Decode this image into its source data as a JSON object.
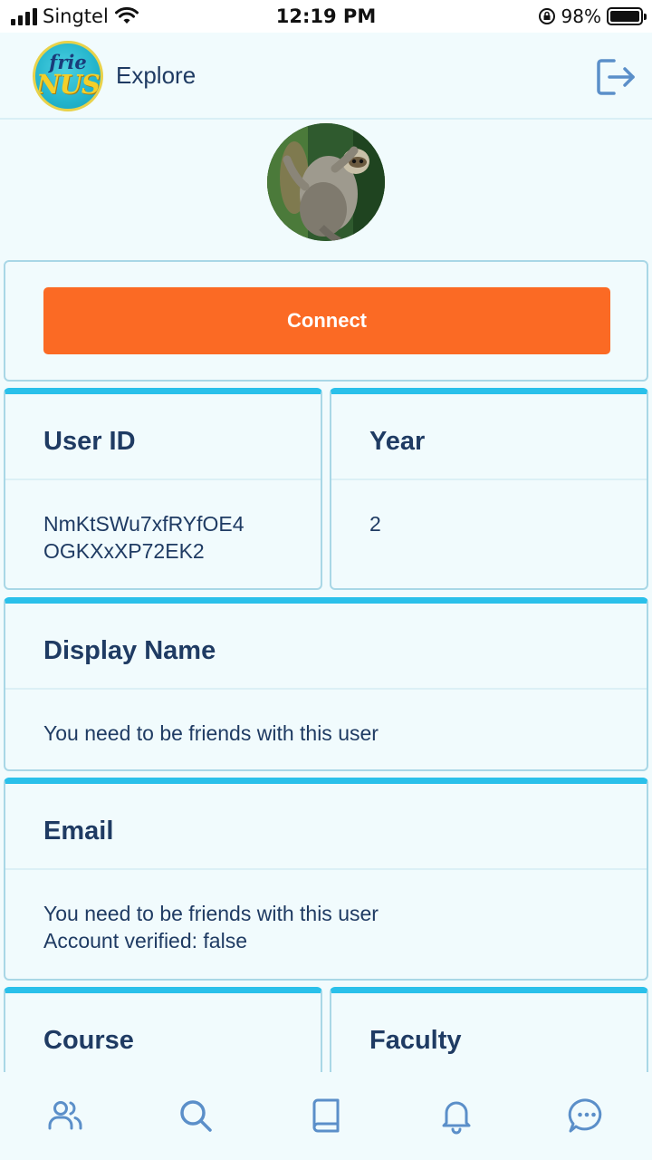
{
  "status_bar": {
    "carrier": "Singtel",
    "time": "12:19 PM",
    "battery": "98%"
  },
  "header": {
    "logo_line1": "frie",
    "logo_line2": "NUS",
    "title": "Explore"
  },
  "profile": {
    "connect_label": "Connect",
    "user_id": {
      "title": "User ID",
      "value_line1": "NmKtSWu7xfRYfOE4",
      "value_line2": "OGKXxXP72EK2"
    },
    "year": {
      "title": "Year",
      "value": "2"
    },
    "display_name": {
      "title": "Display Name",
      "value": "You need to be friends with this user"
    },
    "email": {
      "title": "Email",
      "value": "You need to be friends with this user",
      "verified": "Account verified: false"
    },
    "course": {
      "title": "Course"
    },
    "faculty": {
      "title": "Faculty"
    }
  },
  "nav": {
    "items": [
      {
        "icon": "users-icon"
      },
      {
        "icon": "search-icon"
      },
      {
        "icon": "book-icon"
      },
      {
        "icon": "bell-icon"
      },
      {
        "icon": "chat-icon"
      }
    ]
  },
  "colors": {
    "background": "#f1fbfd",
    "text": "#1f3b63",
    "accent": "#2ac0ea",
    "connect": "#fb6a24",
    "icon": "#5b8fc9"
  }
}
